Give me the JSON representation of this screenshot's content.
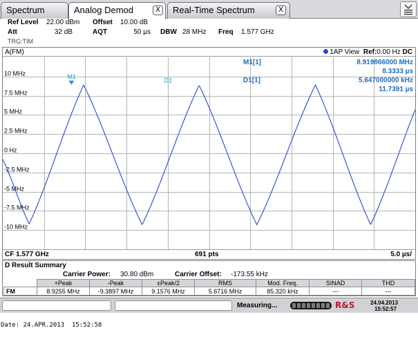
{
  "tabs": [
    {
      "label": "Spectrum",
      "active": false,
      "closable": false
    },
    {
      "label": "Analog Demod",
      "active": true,
      "closable": true
    },
    {
      "label": "Real-Time Spectrum",
      "active": false,
      "closable": true
    }
  ],
  "tab_close_glyph": "X",
  "settings": {
    "ref_level_label": "Ref Level",
    "ref_level_value": "22.00 dBm",
    "offset_label": "Offset",
    "offset_value": "10.00 dB",
    "att_label": "Att",
    "att_value": "32 dB",
    "aqt_label": "AQT",
    "aqt_value": "50 µs",
    "dbw_label": "DBW",
    "dbw_value": "28 MHz",
    "freq_label": "Freq",
    "freq_value": "1.577 GHz",
    "trigger": "TRG:TIM"
  },
  "diagram": {
    "trace_title": "A(FM)",
    "view_label": "1AP View",
    "ref_label": "Ref:",
    "ref_value": "0.00 Hz",
    "coupling": "DC",
    "y_tick_labels": [
      "10 MHz",
      "7.5 MHz",
      "5 MHz",
      "2.5 MHz",
      "0 Hz",
      "-2.5 MHz",
      "-5 MHz",
      "-7.5 MHz",
      "-10 MHz"
    ],
    "marker_m1_label": "M1",
    "marker_d1_label": "D1",
    "readout": {
      "m1_label": "M1[1]",
      "m1_freq": "8.919866000 MHz",
      "m1_time": "8.3333 µs",
      "d1_label": "D1[1]",
      "d1_freq": "5.647000000 kHz",
      "d1_time": "11.7391 µs"
    },
    "footer_cf": "CF 1.577 GHz",
    "footer_pts": "691 pts",
    "footer_div": "5.0 µs/"
  },
  "chart_data": {
    "type": "line",
    "x_range_us": [
      0,
      50
    ],
    "ylim_mhz": [
      -12.5,
      12.5
    ],
    "y_ticks_mhz": [
      10,
      7.5,
      5,
      2.5,
      0,
      -2.5,
      -5,
      -7.5,
      -10
    ],
    "x_divisions": 10,
    "points": 691,
    "series": [
      {
        "x_us": [
          0,
          3.2,
          9.8,
          16.9,
          23.8,
          30.8,
          37.9,
          44.6,
          51.3,
          52.0
        ],
        "y_mhz": [
          -0.8,
          -9.2,
          8.9,
          -9.3,
          8.85,
          -9.3,
          8.9,
          -9.3,
          8.95,
          8.8
        ],
        "color": "#2a46c8"
      }
    ],
    "markers": [
      {
        "name": "M1",
        "x_us": 8.3333,
        "y_mhz": 8.92
      },
      {
        "name": "D1",
        "x_us": 20.0724,
        "y_mhz": 8.93
      }
    ]
  },
  "summary": {
    "title": "D Result Summary",
    "carrier_power_label": "Carrier Power:",
    "carrier_power_value": "30.80 dBm",
    "carrier_offset_label": "Carrier Offset:",
    "carrier_offset_value": "-173.55 kHz",
    "headers": [
      "+Peak",
      "-Peak",
      "±Peak/2",
      "RMS",
      "Mod. Freq.",
      "SINAD",
      "THD"
    ],
    "row_label": "FM",
    "values": [
      "8.9255 MHz",
      "-9.3897 MHz",
      "9.1576 MHz",
      "5.6716 MHz",
      "85.320 kHz",
      "---",
      "---"
    ]
  },
  "status": {
    "measuring": "Measuring...",
    "rs_badge": "R&S",
    "date": "24.04.2013",
    "time": "15:52:57"
  },
  "footer": {
    "label": "Date:",
    "value": "24.APR.2013  15:52:58"
  },
  "colors": {
    "trace": "#2a46c8",
    "marker": "#1f9ac7",
    "readout": "#1f6fb8",
    "grid": "#b3b3b3",
    "rs_red": "#c0142a"
  }
}
